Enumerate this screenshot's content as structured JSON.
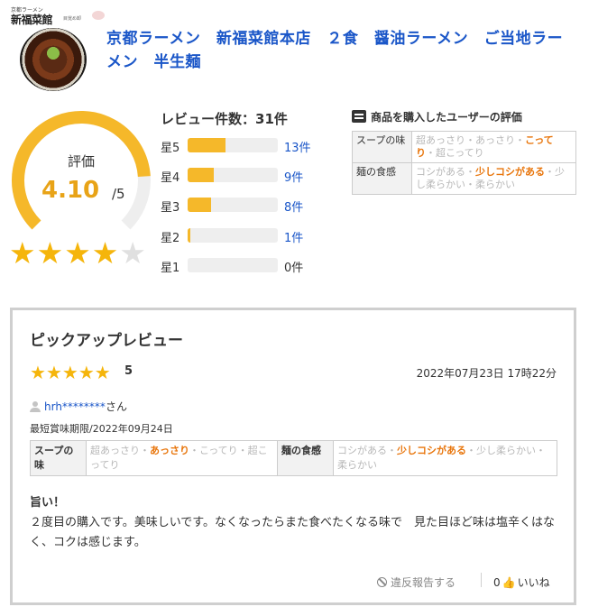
{
  "product": {
    "logo_small": "京都ラーメン",
    "logo_big": "新福菜館",
    "logo_sub": "目覚め卸",
    "title": "京都ラーメン　新福菜館本店　２食　醤油ラーメン　ご当地ラーメン　半生麺"
  },
  "rating": {
    "label": "評価",
    "value": "4.10",
    "denominator": "/5",
    "average": 4.1,
    "max": 5,
    "stars": [
      "★",
      "★",
      "★",
      "★",
      "★"
    ]
  },
  "reviews": {
    "count_title": "レビュー件数：31件",
    "histogram": [
      {
        "label": "星5",
        "count": "13件",
        "fraction": 0.42
      },
      {
        "label": "星4",
        "count": "9件",
        "fraction": 0.29
      },
      {
        "label": "星3",
        "count": "8件",
        "fraction": 0.26
      },
      {
        "label": "星2",
        "count": "1件",
        "fraction": 0.03
      },
      {
        "label": "星1",
        "count": "0件",
        "fraction": 0.0
      }
    ]
  },
  "user_eval": {
    "heading": "商品を購入したユーザーの評価",
    "rows": [
      {
        "key": "スープの味",
        "before": "超あっさり・あっさり・",
        "selected": "こってり",
        "after": "・超こってり"
      },
      {
        "key": "麺の食感",
        "before": "コシがある・",
        "selected": "少しコシがある",
        "after": "・少し柔らかい・柔らかい"
      }
    ]
  },
  "pickup": {
    "title": "ピックアップレビュー",
    "stars": [
      "★",
      "★",
      "★",
      "★",
      "★"
    ],
    "score": "5",
    "date": "2022年07月23日 17時22分",
    "user": "hrh********",
    "user_suffix": "さん",
    "expiry": "最短賞味期限/2022年09月24日",
    "eval": [
      {
        "key": "スープの味",
        "before": "超あっさり・",
        "selected": "あっさり",
        "after": "・こってり・超こってり"
      },
      {
        "key": "麺の食感",
        "before": "コシがある・",
        "selected": "少しコシがある",
        "after": "・少し柔らかい・柔らかい"
      }
    ],
    "heading": "旨い！",
    "body": "２度目の購入です。美味しいです。なくなったらまた食べたくなる味で　見た目ほど味は塩辛くはなく、コクは感じます。",
    "report_label": "違反報告する",
    "like_count": "0",
    "like_label": "いいね"
  },
  "colors": {
    "accent_gold": "#f5b50b",
    "link_blue": "#1a56c8",
    "selected_orange": "#e8750b"
  }
}
